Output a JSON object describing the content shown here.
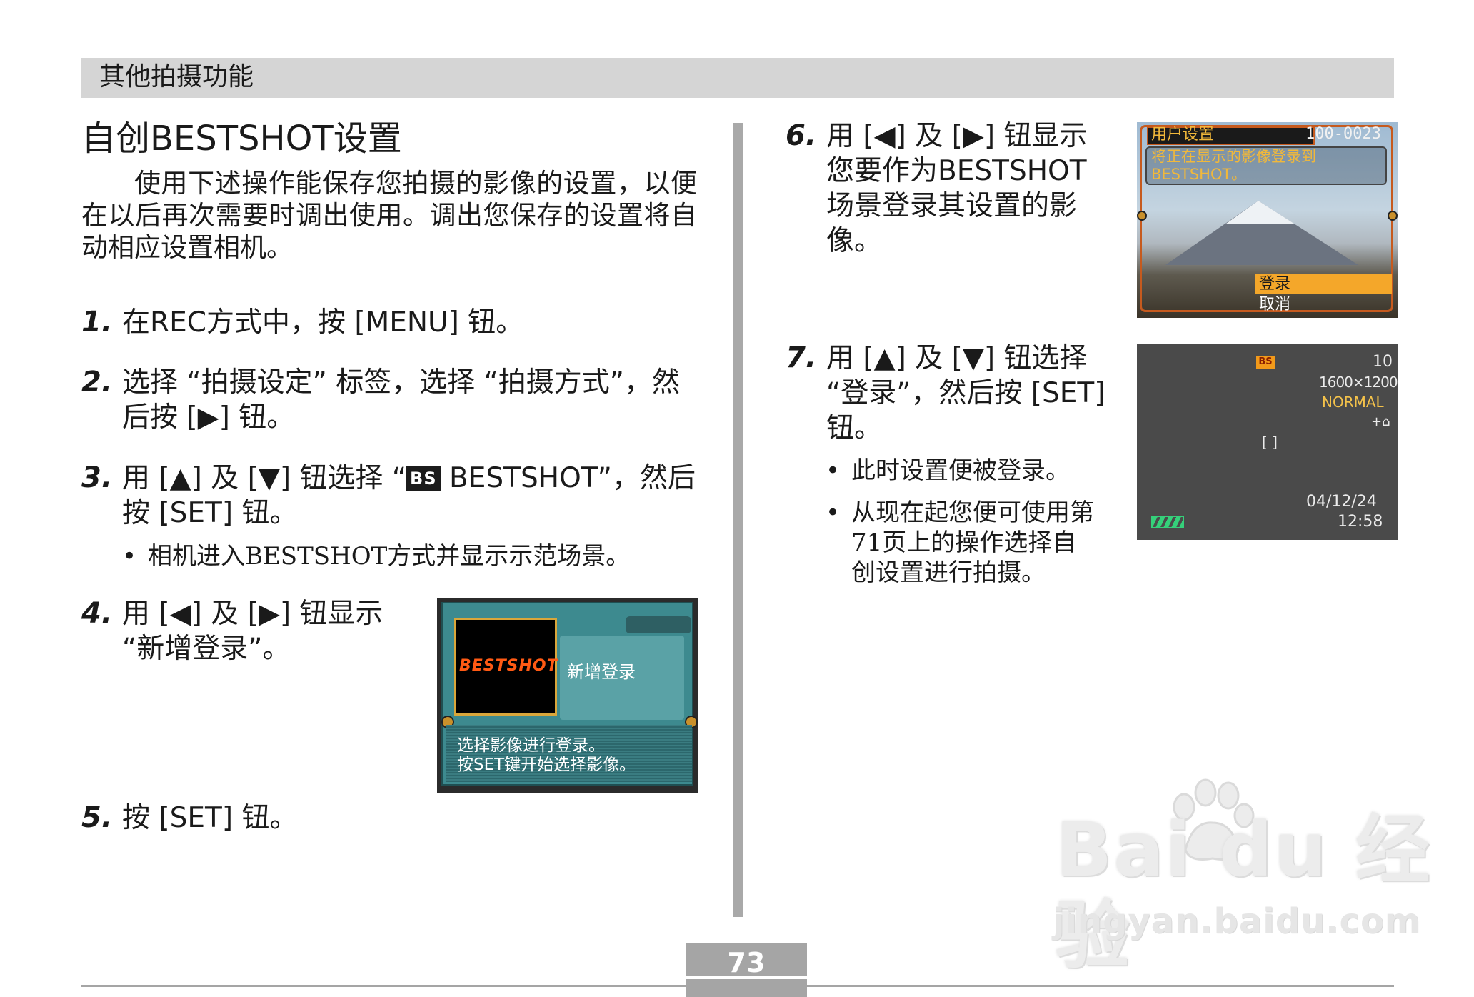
{
  "header": {
    "section": "其他拍摄功能"
  },
  "title": "自创BESTSHOT设置",
  "intro": "使用下述操作能保存您拍摄的影像的设置，以便在以后再次需要时调出使用。调出您保存的设置将自动相应设置相机。",
  "steps": [
    {
      "num": "1.",
      "text": "在REC方式中，按 [MENU] 钮。"
    },
    {
      "num": "2.",
      "text": "选择 “拍摄设定” 标签，选择 “拍摄方式”，然后按 [▶] 钮。"
    },
    {
      "num": "3.",
      "text_a": "用 [▲] 及 [▼] 钮选择 “",
      "badge": "BS",
      "text_b": " BESTSHOT”，然后按 [SET] 钮。",
      "bullet": "相机进入BESTSHOT方式并显示示范场景。"
    },
    {
      "num": "4.",
      "text": "用 [◀] 及 [▶] 钮显示 “新增登录”。"
    },
    {
      "num": "5.",
      "text": "按 [SET] 钮。"
    },
    {
      "num": "6.",
      "text": "用 [◀] 及 [▶] 钮显示您要作为BESTSHOT场景登录其设置的影像。"
    },
    {
      "num": "7.",
      "text": "用 [▲] 及 [▼] 钮选择 “登录”，然后按 [SET] 钮。",
      "bullets": [
        "此时设置便被登录。",
        "从现在起您便可使用第71页上的操作选择自创设置进行拍摄。"
      ]
    }
  ],
  "screen1": {
    "logo": "BESTSHOT",
    "option": "新增登录",
    "message": "选择影像进行登录。\n按SET键开始选择影像。"
  },
  "screen2": {
    "title": "用户设置",
    "file_no": "100-0023",
    "message": "将正在显示的影像登录到\nBESTSHOT。",
    "opt_register": "登录",
    "opt_cancel": "取消"
  },
  "screen3": {
    "mode_badge": "BS",
    "shots": "10",
    "size": "1600×1200",
    "quality": "NORMAL",
    "flash": "+⌂",
    "date": "04/12/24",
    "time": "12:58",
    "brackets": "[  ]"
  },
  "page_number": "73",
  "watermark": {
    "main": "Bai du 经验",
    "sub": "jingyan.baidu.com"
  },
  "colors": {
    "accent_orange": "#f4a72a",
    "screen_teal": "#3d8a8f",
    "divider_gray": "#a9a9a9"
  }
}
